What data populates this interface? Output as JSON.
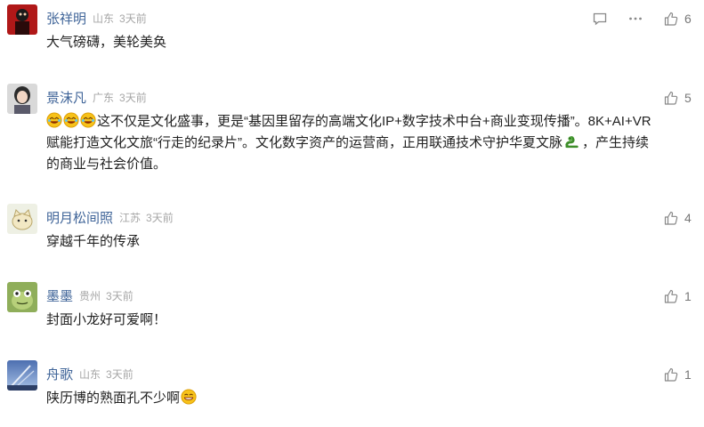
{
  "comments": [
    {
      "user": "张祥明",
      "location": "山东",
      "time": "3天前",
      "text": "大气磅礴，美轮美奂",
      "likes": "6",
      "avatar": "avatar-red-figure"
    },
    {
      "user": "景沫凡",
      "location": "广东",
      "time": "3天前",
      "text": "这不仅是文化盛事，更是“基因里留存的高端文化IP+数字技术中台+商业变现传播”。8K+AI+VR赋能打造文化文旅“行走的纪录片”。文化数字资产的运营商，正用联通技术守护华夏文脉",
      "text_tail": "，产生持续的商业与社会价值。",
      "likes": "5",
      "avatar": "avatar-woman-photo",
      "emoji": "laughing-emoji",
      "emoji_tail": "snake-emoji"
    },
    {
      "user": "明月松间照",
      "location": "江苏",
      "time": "3天前",
      "text": "穿越千年的传承",
      "likes": "4",
      "avatar": "avatar-cartoon-cat"
    },
    {
      "user": "墨墨",
      "location": "贵州",
      "time": "3天前",
      "text": "封面小龙好可爱啊！",
      "likes": "1",
      "avatar": "avatar-cartoon-frog"
    },
    {
      "user": "舟歌",
      "location": "山东",
      "time": "3天前",
      "text": "陕历博的熟面孔不少啊",
      "likes": "1",
      "avatar": "avatar-sky-scene",
      "emoji_tail": "grin-emoji"
    }
  ],
  "icons": {
    "reply": "reply-icon",
    "more": "more-icon",
    "like": "thumbs-up-icon"
  },
  "colors": {
    "username": "#406599",
    "meta": "#a6a6a6",
    "text": "#222222",
    "icon": "#888888"
  }
}
